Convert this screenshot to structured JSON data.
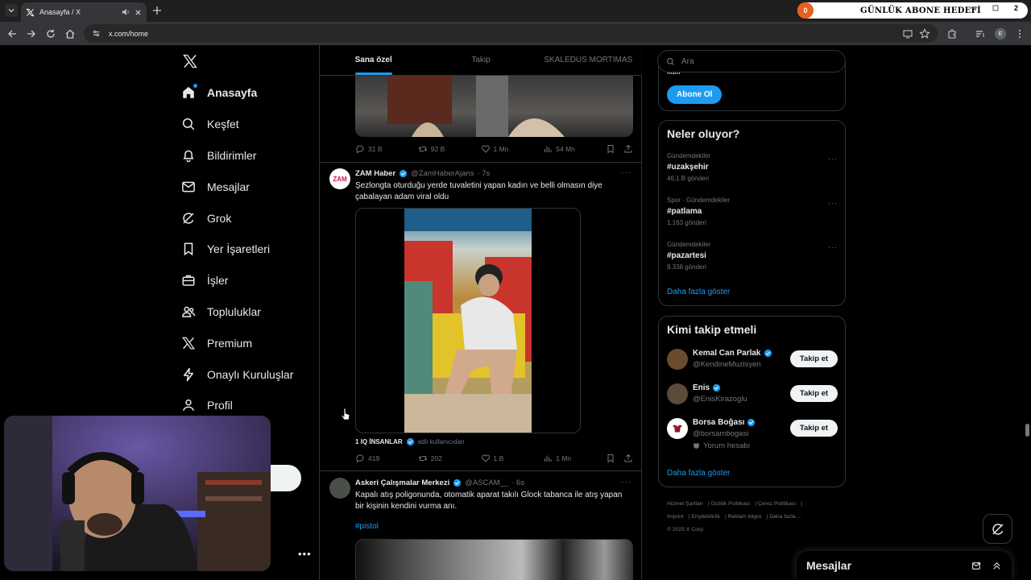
{
  "browser": {
    "tab_title": "Anasayfa / X",
    "url": "x.com/home",
    "profile_initial": "E",
    "overlay_count": "0",
    "overlay_title": "GÜNLÜK ABONE HEDEFİ",
    "overlay_right": "2"
  },
  "nav": {
    "items": [
      {
        "label": "Anasayfa",
        "icon": "home-icon"
      },
      {
        "label": "Keşfet",
        "icon": "search-icon"
      },
      {
        "label": "Bildirimler",
        "icon": "bell-icon"
      },
      {
        "label": "Mesajlar",
        "icon": "mail-icon"
      },
      {
        "label": "Grok",
        "icon": "grok-icon"
      },
      {
        "label": "Yer İşaretleri",
        "icon": "bookmark-icon"
      },
      {
        "label": "İşler",
        "icon": "briefcase-icon"
      },
      {
        "label": "Topluluklar",
        "icon": "people-icon"
      },
      {
        "label": "Premium",
        "icon": "x-logo-icon"
      },
      {
        "label": "Onaylı Kuruluşlar",
        "icon": "lightning-icon"
      },
      {
        "label": "Profil",
        "icon": "person-icon"
      }
    ]
  },
  "timeline": {
    "tabs": [
      "Sana özel",
      "Takip",
      "SKALEDUS MORTIMAS"
    ],
    "tweet1": {
      "replies": "31 B",
      "retweets": "92 B",
      "likes": "1 Mn",
      "views": "54 Mn"
    },
    "tweet2": {
      "name": "ZAM Haber",
      "handle": "@ZamHaberAjans",
      "time": "· 7s",
      "avatar_text": "ZAM",
      "text": "Şezlongta oturduğu yerde tuvaletini yapan kadın ve belli olmasın diye çabalayan adam viral oldu",
      "source_name": "1 IQ İNSANLAR",
      "source_suffix": "adlı kullanıcıdan",
      "replies": "419",
      "retweets": "202",
      "likes": "1 B",
      "views": "1 Mn"
    },
    "tweet3": {
      "name": "Askeri Çalışmalar Merkezi",
      "handle": "@ASCAM__",
      "time": "· 6s",
      "text": "Kapalı atış poligonunda, otomatik aparat takılı Glock tabanca ile atış yapan bir kişinin kendini vurma anı.",
      "hashtag": "#pistol"
    }
  },
  "sidebar_right": {
    "search_placeholder": "Ara",
    "premium_cut_text": "katıl",
    "subscribe_label": "Abone Ol",
    "trends_title": "Neler oluyor?",
    "trends": [
      {
        "meta": "Gündemdekiler",
        "name": "#uzakşehir",
        "count": "46,1 B gönderi"
      },
      {
        "meta": "Spor · Gündemdekiler",
        "name": "#patlama",
        "count": "1.163 gönderi"
      },
      {
        "meta": "Gündemdekiler",
        "name": "#pazartesi",
        "count": "9.336 gönderi"
      }
    ],
    "trends_more": "Daha fazla göster",
    "who_title": "Kimi takip etmeli",
    "who": [
      {
        "name": "Kemal Can Parlak",
        "handle": "@KendineMuzisyen",
        "extra": "",
        "color": "#6b4a2e"
      },
      {
        "name": "Enis",
        "handle": "@EnisKirazoglu",
        "extra": "",
        "color": "#5c4a3a"
      },
      {
        "name": "Borsa Boğası",
        "handle": "@borsambogasi",
        "extra": "Yorum hesabı",
        "color": "#8a1c2b"
      }
    ],
    "follow_label": "Takip et",
    "who_more": "Daha fazla göster",
    "footer": [
      "Hizmet Şartları",
      "Gizlilik Politikası",
      "Çerez Politikası",
      "Imprint",
      "Erişilebilirlik",
      "Reklam bilgisi",
      "Daha fazla ...",
      "© 2025 X Corp."
    ],
    "messages_title": "Mesajlar"
  },
  "colors": {
    "accent": "#1d9bf0",
    "background": "#000000",
    "border": "#2f3336"
  }
}
